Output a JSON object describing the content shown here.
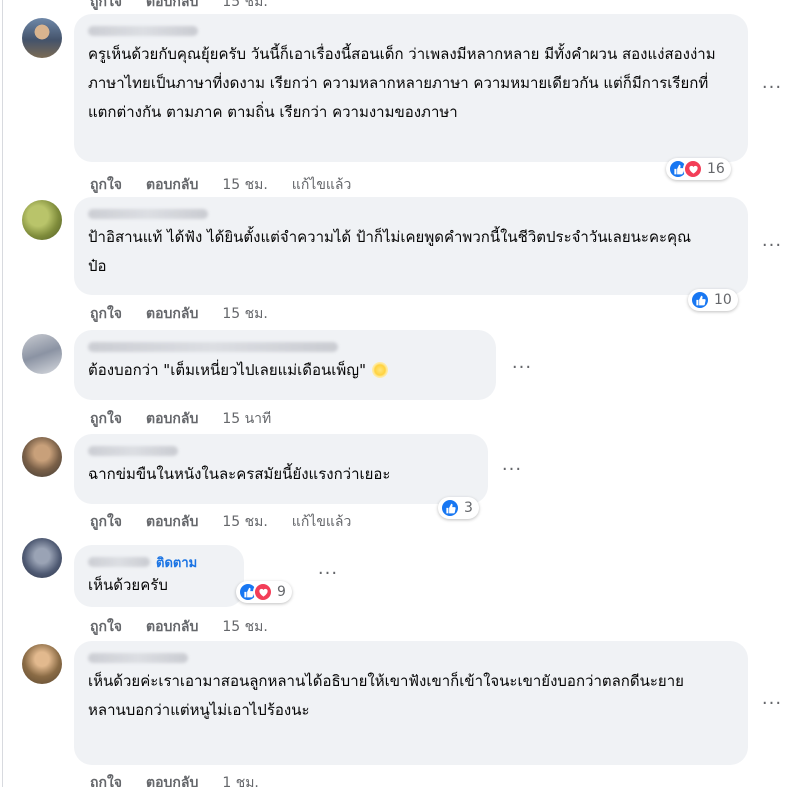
{
  "common": {
    "like_label": "ถูกใจ",
    "reply_label": "ตอบกลับ",
    "edited_label": "แก้ไขแล้ว",
    "follow_label": "ติดตาม",
    "more_label": "···"
  },
  "colors": {
    "bubble_bg": "#f0f2f5",
    "secondary_text": "#65676b",
    "like_blue": "#1877f2",
    "love_red": "#f33e58",
    "follow_blue": "#1b74e4"
  },
  "top_partial": {
    "like_label": "ถูกใจ",
    "reply_label": "ตอบกลับ",
    "time": "15 ชม."
  },
  "comments": [
    {
      "text": "ครูเห็นด้วยกับคุณยุ้ยครับ วันนี้ก็เอาเรื่องนี้สอนเด็ก ว่าเพลงมีหลากหลาย มีทั้งคำผวน สองแง่สองง่าม ภาษาไทยเป็นภาษาที่งดงาม เรียกว่า ความหลากหลายภาษา ความหมายเดียวกัน แต่ก็มีการเรียกที่แตกต่างกัน ตามภาค ตามถิ่น เรียกว่า ความงามของภาษา",
      "reactions": [
        "like-icon",
        "love-icon"
      ],
      "reaction_count": "16",
      "time": "15 ชม.",
      "edited": true
    },
    {
      "text": "ป้าอิสานแท้ ได้ฟัง ได้ยินตั้งแต่จำความได้ ป้าก็ไม่เคยพูดคำพวกนี้ในชีวิตประจำวันเลยนะคะคุณป๋อ",
      "reactions": [
        "like-icon"
      ],
      "reaction_count": "10",
      "time": "15 ชม.",
      "edited": false
    },
    {
      "text": "ต้องบอกว่า \"เต็มเหนี่ยวไปเลยแม่เดือนเพ็ญ\"",
      "emoji": "sun-emoji",
      "reactions": [],
      "reaction_count": "",
      "time": "15 นาที",
      "edited": false
    },
    {
      "text": "ฉากข่มขืนในหนังในละครสมัยนี้ยังแรงกว่าเยอะ",
      "reactions": [
        "like-icon"
      ],
      "reaction_count": "3",
      "time": "15 ชม.",
      "edited": true
    },
    {
      "text": "เห็นด้วยครับ",
      "follow": true,
      "reactions": [
        "like-icon",
        "love-icon"
      ],
      "reaction_count": "9",
      "time": "15 ชม.",
      "edited": false
    },
    {
      "text": "เห็นด้วยค่ะเราเอามาสอนลูกหลานได้อธิบายให้เขาฟังเขาก็เข้าใจนะเขายังบอกว่าตลกดีนะยาย\nหลานบอกว่าแต่หนูไม่เอาไปร้องนะ",
      "reactions": [],
      "reaction_count": "",
      "time": "1 ชม.",
      "edited": false
    }
  ]
}
